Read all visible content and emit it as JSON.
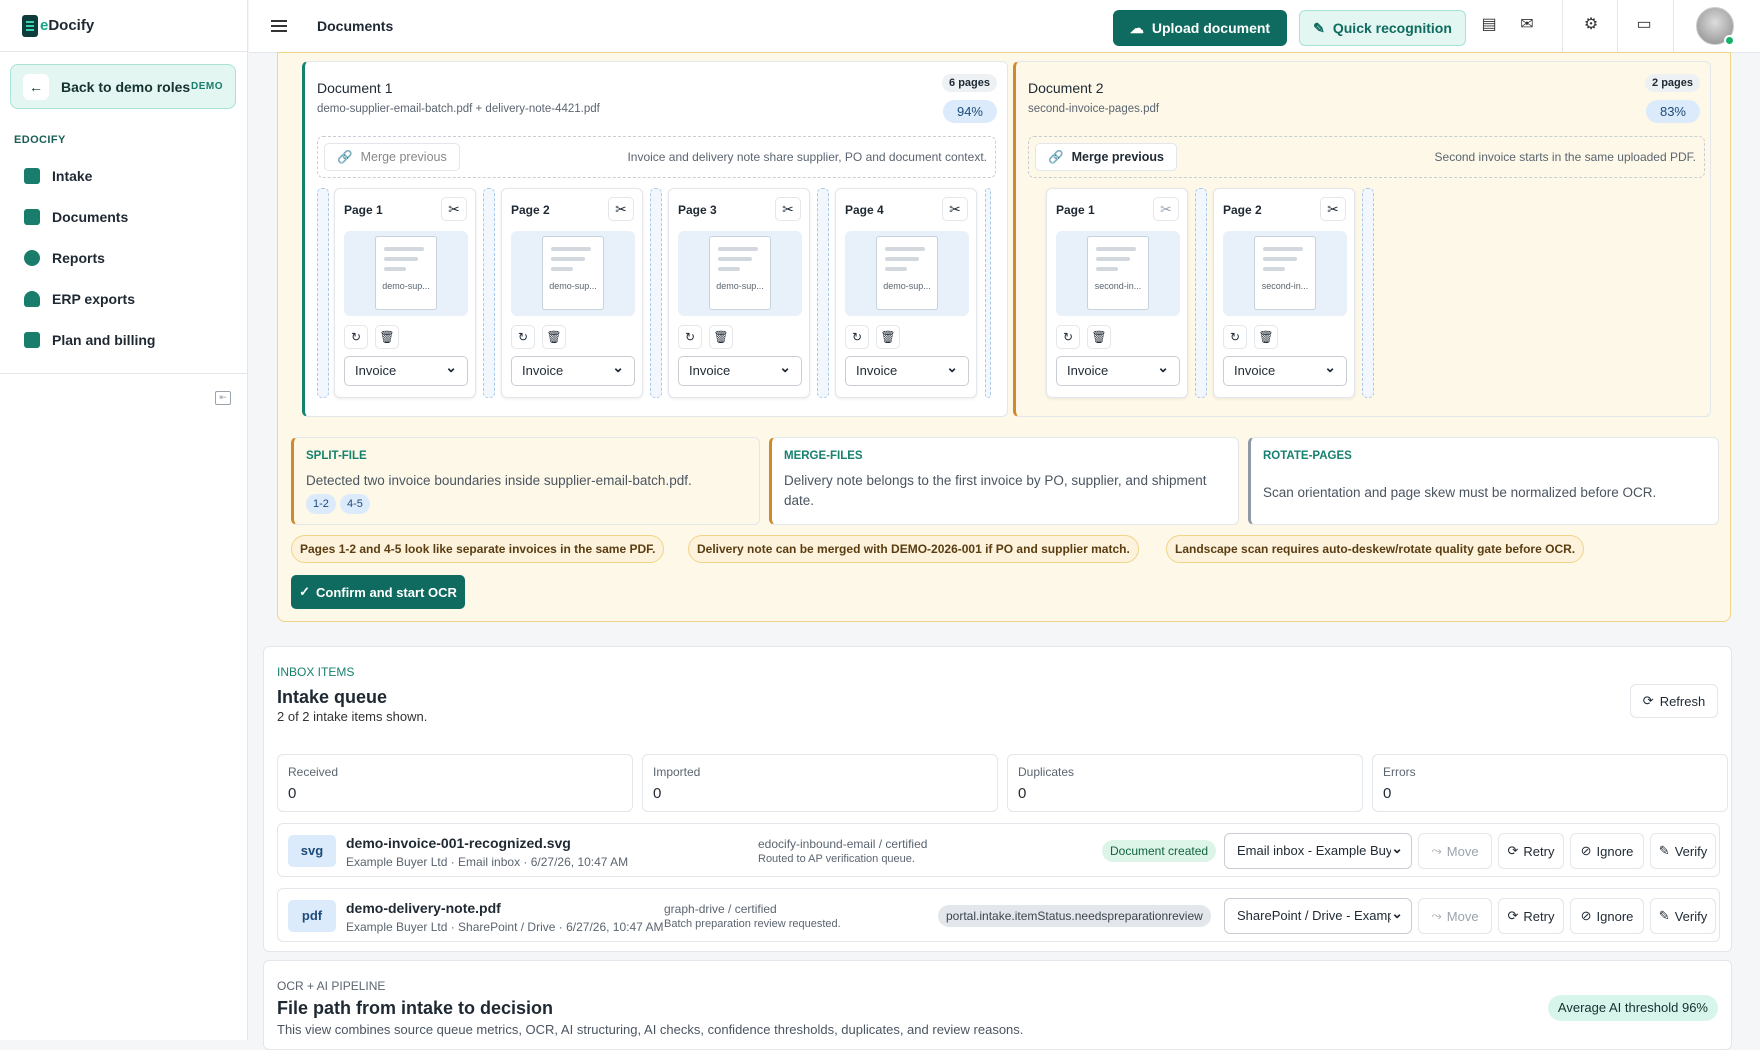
{
  "app": {
    "logo_prefix": "e",
    "logo_name": "Docify",
    "page_title": "Documents"
  },
  "sidebar": {
    "back_label": "Back to demo roles",
    "back_badge": "DEMO",
    "section": "EDOCIFY",
    "items": [
      {
        "label": "Intake",
        "icon": "inbox-icon"
      },
      {
        "label": "Documents",
        "icon": "document-icon"
      },
      {
        "label": "Reports",
        "icon": "pie-chart-icon"
      },
      {
        "label": "ERP exports",
        "icon": "cloud-upload-icon"
      },
      {
        "label": "Plan and billing",
        "icon": "credit-card-icon"
      }
    ]
  },
  "topbar": {
    "upload_label": "Upload document",
    "quick_label": "Quick recognition"
  },
  "prep": {
    "doc1": {
      "title": "Document 1",
      "files": "demo-supplier-email-batch.pdf + delivery-note-4421.pdf",
      "pages": "6 pages",
      "confidence": "94%",
      "merge_label": "Merge previous",
      "merge_note": "Invoice and delivery note share supplier, PO and document context.",
      "cards": [
        {
          "label": "Page 1",
          "thumb": "demo-sup...",
          "type": "Invoice"
        },
        {
          "label": "Page 2",
          "thumb": "demo-sup...",
          "type": "Invoice"
        },
        {
          "label": "Page 3",
          "thumb": "demo-sup...",
          "type": "Invoice"
        },
        {
          "label": "Page 4",
          "thumb": "demo-sup...",
          "type": "Invoice"
        }
      ]
    },
    "doc2": {
      "title": "Document 2",
      "files": "second-invoice-pages.pdf",
      "pages": "2 pages",
      "confidence": "83%",
      "merge_label": "Merge previous",
      "merge_note": "Second invoice starts in the same uploaded PDF.",
      "cards": [
        {
          "label": "Page 1",
          "thumb": "second-in...",
          "type": "Invoice"
        },
        {
          "label": "Page 2",
          "thumb": "second-in...",
          "type": "Invoice"
        }
      ]
    },
    "recs": [
      {
        "head": "SPLIT-FILE",
        "text": "Detected two invoice boundaries inside supplier-email-batch.pdf.",
        "chips": [
          "1-2",
          "4-5"
        ]
      },
      {
        "head": "MERGE-FILES",
        "text": "Delivery note belongs to the first invoice by PO, supplier, and shipment date."
      },
      {
        "head": "ROTATE-PAGES",
        "text": "Scan orientation and page skew must be normalized before OCR."
      }
    ],
    "warnings": [
      "Pages 1-2 and 4-5 look like separate invoices in the same PDF.",
      "Delivery note can be merged with DEMO-2026-001 if PO and supplier match.",
      "Landscape scan requires auto-deskew/rotate quality gate before OCR."
    ],
    "confirm_label": "Confirm and start OCR"
  },
  "inbox": {
    "kicker": "INBOX ITEMS",
    "title": "Intake queue",
    "subtitle": "2 of 2 intake items shown.",
    "refresh_label": "Refresh",
    "stats": [
      {
        "label": "Received",
        "value": "0"
      },
      {
        "label": "Imported",
        "value": "0"
      },
      {
        "label": "Duplicates",
        "value": "0"
      },
      {
        "label": "Errors",
        "value": "0"
      }
    ],
    "rows": [
      {
        "type": "svg",
        "name": "demo-invoice-001-recognized.svg",
        "meta": "Example Buyer Ltd · Email inbox · 6/27/26, 10:47 AM",
        "source": "edocify-inbound-email / certified",
        "note": "Routed to AP verification queue.",
        "status": "Document created",
        "target": "Email inbox - Example Buy",
        "move": "Move",
        "retry": "Retry",
        "ignore": "Ignore",
        "verify": "Verify"
      },
      {
        "type": "pdf",
        "name": "demo-delivery-note.pdf",
        "meta": "Example Buyer Ltd · SharePoint / Drive · 6/27/26, 10:47 AM",
        "source": "graph-drive / certified",
        "note": "Batch preparation review requested.",
        "status": "portal.intake.itemStatus.needspreparationreview",
        "target": "SharePoint / Drive - Examp",
        "move": "Move",
        "retry": "Retry",
        "ignore": "Ignore",
        "verify": "Verify"
      }
    ]
  },
  "pipeline": {
    "kicker": "OCR + AI PIPELINE",
    "title": "File path from intake to decision",
    "subtitle": "This view combines source queue metrics, OCR, AI structuring, AI checks, confidence thresholds, duplicates, and review reasons.",
    "threshold": "Average AI threshold 96%"
  }
}
